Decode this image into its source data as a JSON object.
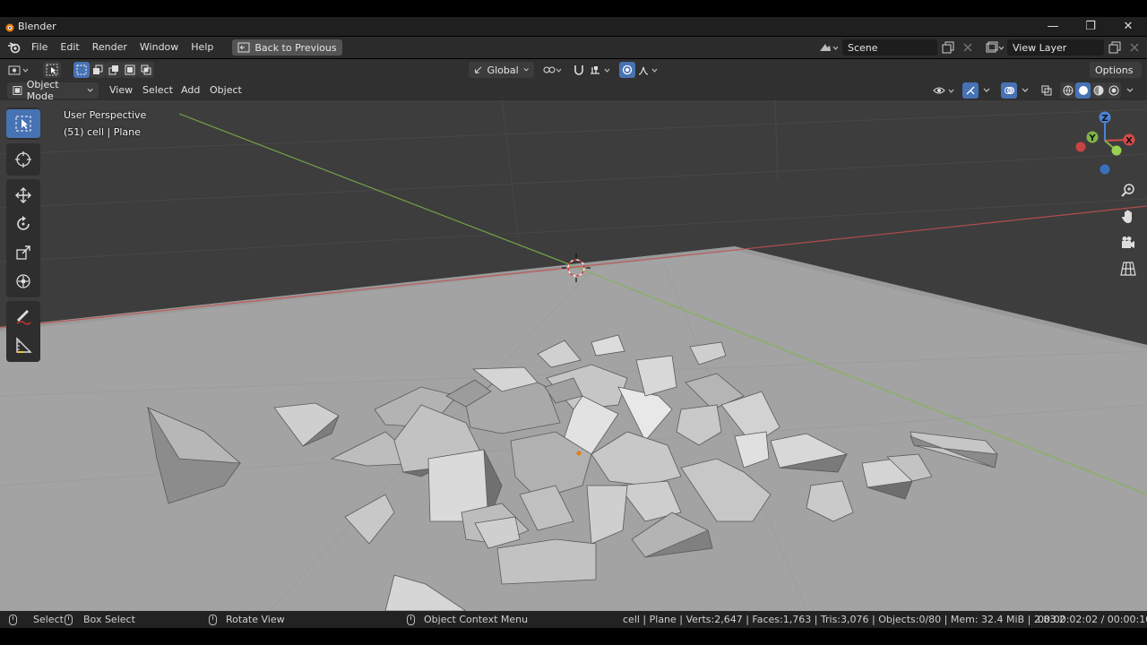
{
  "window": {
    "title": "Blender",
    "minimize_glyph": "—",
    "maximize_glyph": "❐",
    "close_glyph": "✕"
  },
  "menubar": {
    "items": [
      "File",
      "Edit",
      "Render",
      "Window",
      "Help"
    ],
    "back_button": "Back to Previous",
    "scene": "Scene",
    "view_layer": "View Layer"
  },
  "toolheader": {
    "transform_orientation": "Global",
    "options": "Options"
  },
  "viewport_header": {
    "mode": "Object Mode",
    "menus": [
      "View",
      "Select",
      "Add",
      "Object"
    ]
  },
  "viewport": {
    "perspective": "User Perspective",
    "active_object": "(51) cell | Plane",
    "background_color": "#3d3d3d",
    "floor_color": "#a3a3a3"
  },
  "toolbar": {
    "tools": [
      "select-box",
      "cursor",
      "move",
      "rotate",
      "scale",
      "transform",
      "annotate",
      "measure"
    ],
    "active": "select-box"
  },
  "gizmo": {
    "x": "X",
    "y": "Y",
    "z": "Z"
  },
  "statusbar": {
    "select": "Select",
    "box_select": "Box Select",
    "rotate_view": "Rotate View",
    "context_menu": "Object Context Menu",
    "stats": "cell | Plane | Verts:2,647 | Faces:1,763 | Tris:3,076 | Objects:0/80 | Mem: 32.4 MiB | 2.83.2",
    "time": "00:00:02:02 / 00:00:10:0"
  },
  "colors": {
    "accent": "#4772b3",
    "x_axis": "#d64a4a",
    "y_axis": "#7fb54a",
    "z_axis": "#4a84d6"
  }
}
